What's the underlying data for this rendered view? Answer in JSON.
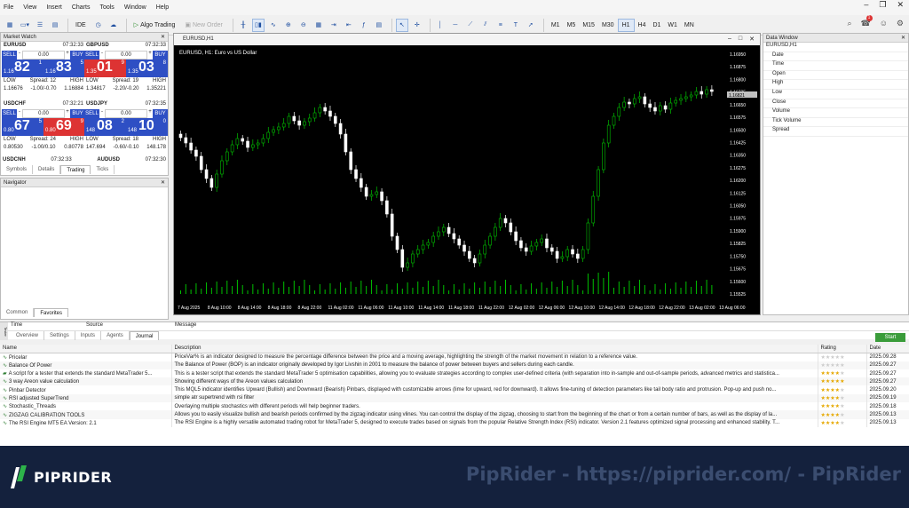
{
  "menu": {
    "items": [
      "File",
      "View",
      "Insert",
      "Charts",
      "Tools",
      "Window",
      "Help"
    ]
  },
  "toolbar": {
    "ide": "IDE",
    "algo": "Algo Trading",
    "new_order": "New Order",
    "timeframes": [
      "M1",
      "M5",
      "M15",
      "M30",
      "H1",
      "H4",
      "D1",
      "W1",
      "MN"
    ],
    "active_tf": "H1",
    "notif_count": "1"
  },
  "market_watch": {
    "title": "Market Watch",
    "tiles": [
      {
        "symbol": "EURUSD",
        "time": "07:32:33",
        "sell": "SELL",
        "buy": "BUY",
        "lot": "0.00",
        "bid_pre": "1.16",
        "bid_big": "82",
        "bid_sup": "1",
        "ask_pre": "1.16",
        "ask_big": "83",
        "ask_sup": "5",
        "low_l": "LOW",
        "spread": "Spread: 12",
        "high_l": "HIGH",
        "low": "1.16676",
        "range": "-1.00/-0.70",
        "high": "1.16884",
        "bid_color": "blue",
        "ask_color": "blue"
      },
      {
        "symbol": "GBPUSD",
        "time": "07:32:33",
        "sell": "SELL",
        "buy": "BUY",
        "lot": "0.00",
        "bid_pre": "1.35",
        "bid_big": "01",
        "bid_sup": "9",
        "ask_pre": "1.35",
        "ask_big": "03",
        "ask_sup": "8",
        "low_l": "LOW",
        "spread": "Spread: 19",
        "high_l": "HIGH",
        "low": "1.34817",
        "range": "-2.20/-0.20",
        "high": "1.35221",
        "bid_color": "red",
        "ask_color": "blue"
      },
      {
        "symbol": "USDCHF",
        "time": "07:32:21",
        "sell": "SELL",
        "buy": "BUY",
        "lot": "0.00",
        "bid_pre": "0.80",
        "bid_big": "67",
        "bid_sup": "5",
        "ask_pre": "0.80",
        "ask_big": "69",
        "ask_sup": "9",
        "low_l": "LOW",
        "spread": "Spread: 24",
        "high_l": "HIGH",
        "low": "0.80530",
        "range": "-1.00/0.10",
        "high": "0.80778",
        "bid_color": "blue",
        "ask_color": "red"
      },
      {
        "symbol": "USDJPY",
        "time": "07:32:35",
        "sell": "SELL",
        "buy": "BUY",
        "lot": "0.00",
        "bid_pre": "148",
        "bid_big": "08",
        "bid_sup": "2",
        "ask_pre": "148",
        "ask_big": "10",
        "ask_sup": "0",
        "low_l": "LOW",
        "spread": "Spread: 18",
        "high_l": "HIGH",
        "low": "147.694",
        "range": "-0.60/-0.10",
        "high": "148.178",
        "bid_color": "blue",
        "ask_color": "blue"
      }
    ],
    "next_row": [
      "USDCNH",
      "07:32:33",
      "AUDUSD",
      "07:32:30"
    ],
    "tabs": [
      "Symbols",
      "Details",
      "Trading",
      "Ticks"
    ],
    "active_tab": "Trading"
  },
  "navigator": {
    "title": "Navigator",
    "tabs": [
      "Common",
      "Favorites"
    ],
    "active_tab": "Favorites"
  },
  "chart": {
    "window_title": "EURUSD,H1",
    "label": "EURUSD, H1: Euro vs US Dollar",
    "price_ticks": [
      "1.16950",
      "1.16875",
      "1.16800",
      "1.16725",
      "1.16650",
      "1.16575",
      "1.16500",
      "1.16425",
      "1.16350",
      "1.16275",
      "1.16200",
      "1.16125",
      "1.16050",
      "1.15975",
      "1.15900",
      "1.15825",
      "1.15750",
      "1.15675",
      "1.15600",
      "1.15525"
    ],
    "current_price": "1.16821",
    "time_ticks": [
      "7 Aug 2025",
      "8 Aug 10:00",
      "8 Aug 14:00",
      "8 Aug 18:00",
      "8 Aug 22:00",
      "11 Aug 02:00",
      "11 Aug 06:00",
      "11 Aug 10:00",
      "11 Aug 14:00",
      "11 Aug 18:00",
      "11 Aug 22:00",
      "12 Aug 02:00",
      "12 Aug 06:00",
      "12 Aug 10:00",
      "12 Aug 14:00",
      "12 Aug 18:00",
      "12 Aug 22:00",
      "13 Aug 02:00",
      "13 Aug 06:00"
    ]
  },
  "data_window": {
    "title": "Data Window",
    "symbol": "EURUSD,H1",
    "fields": [
      "Date",
      "Time",
      "Open",
      "High",
      "Low",
      "Close",
      "Volume",
      "Tick Volume",
      "Spread"
    ]
  },
  "toolbox": {
    "cols": [
      "Time",
      "Source",
      "Message"
    ],
    "tabs": [
      "Overview",
      "Settings",
      "Inputs",
      "Agents",
      "Journal"
    ],
    "active_tab": "Journal",
    "side_label": "Tester"
  },
  "market": {
    "start": "Start",
    "headers": [
      "Name",
      "Description",
      "Rating",
      "Date"
    ],
    "rows": [
      {
        "name": "Pricelar",
        "desc": "PriceVar% is an indicator designed to measure the percentage difference between the price and a moving average, highlighting the strength of the market movement in relation to a reference value.",
        "stars": 0,
        "date": "2025.09.28"
      },
      {
        "name": "Balance Of Power",
        "desc": "The Balance of Power (BOP) is an indicator originally developed by Igor Livshin in 2001 to measure the balance of power between buyers and sellers during each candle.",
        "stars": 0,
        "date": "2025.09.27"
      },
      {
        "name": "A script for a tester that extends the standard MetaTrader 5...",
        "desc": "This is a tester script that extends the standard MetaTrader 5 optimisation capabilities, allowing you to evaluate strategies according to complex user-defined criteria (with separation into in-sample and out-of-sample periods, advanced metrics and statistica...",
        "stars": 4,
        "date": "2025.09.27"
      },
      {
        "name": "3 way Areon value calculation",
        "desc": "Showing different ways of the Areon values calculation",
        "stars": 5,
        "date": "2025.09.27"
      },
      {
        "name": "Pinbar Detector",
        "desc": "This MQL5 indicator identifies Upward (Bullish) and Downward (Bearish) Pinbars, displayed with customizable arrows (lime for upward, red for downward). It allows fine-tuning of detection parameters like tail body ratio and protrusion. Pop-up and push no...",
        "stars": 4,
        "date": "2025.09.20"
      },
      {
        "name": "RSI adjusted SuperTrend",
        "desc": "simple atr supertrend with rsi filter",
        "stars": 4,
        "date": "2025.09.19"
      },
      {
        "name": "Stochastic_Threads",
        "desc": "Overlaying multiple stochastics with different periods will help beginner traders.",
        "stars": 4,
        "date": "2025.09.18"
      },
      {
        "name": "ZIGZAG CALIBRATION TOOLS",
        "desc": "Allows you to easily visualize bullish and bearish periods confirmed by the zigzag indicator using vlines. You can control the display of the zigzag, choosing to start from the beginning of the chart or from a certain number of bars, as well as the display of la...",
        "stars": 4,
        "date": "2025.09.13"
      },
      {
        "name": "The RSI Engine MT5 EA Version: 2.1",
        "desc": "The RSI Engine is a highly versatile automated trading robot for MetaTrader 5, designed to execute trades based on signals from the popular Relative Strength Index (RSI) indicator. Version 2.1 features optimized signal processing and enhanced stability. T...",
        "stars": 4,
        "date": "2025.09.13"
      }
    ]
  },
  "banner": {
    "brand": "PIPRIDER",
    "watermark": "PipRider - https://piprider.com/ - PipRider"
  },
  "colors": {
    "bull": "#00c000",
    "bear": "#ffffff",
    "chart_bg": "#000000",
    "banner_bg": "#14213d",
    "accent_blue": "#2e4fc4",
    "accent_red": "#dd3333"
  }
}
